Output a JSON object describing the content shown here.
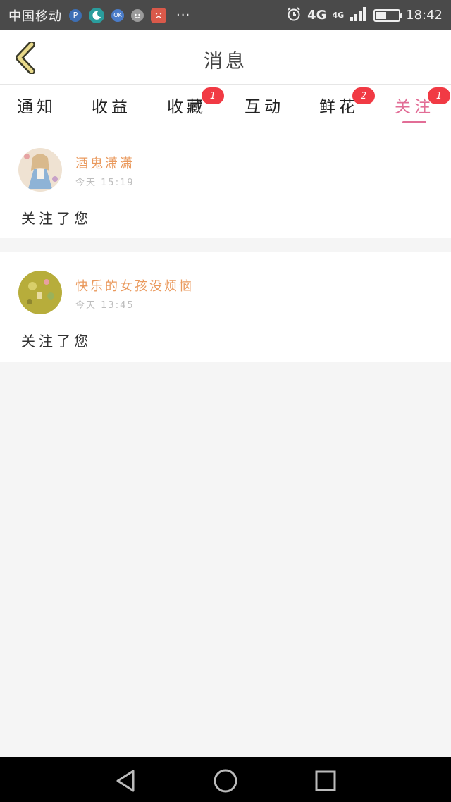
{
  "status_bar": {
    "carrier": "中国移动",
    "more": "···",
    "network_large": "4G",
    "network_small": "4G",
    "time": "18:42",
    "battery_level": 0.45,
    "icons": [
      "app-icon-p",
      "moon-app-icon",
      "ok-app-icon",
      "face-app-icon",
      "sad-app-icon",
      "alarm-icon",
      "signal-icon",
      "battery-icon"
    ]
  },
  "header": {
    "title": "消息"
  },
  "tabs": [
    {
      "label": "通知",
      "badge": ""
    },
    {
      "label": "收益",
      "badge": ""
    },
    {
      "label": "收藏",
      "badge": "1"
    },
    {
      "label": "互动",
      "badge": ""
    },
    {
      "label": "鲜花",
      "badge": "2"
    },
    {
      "label": "关注",
      "badge": "1",
      "active": true
    }
  ],
  "colors": {
    "accent": "#e26d96",
    "badge": "#f13a44",
    "username": "#ea9a5e",
    "back_arrow": "#e8d98a"
  },
  "messages": [
    {
      "username": "酒鬼潇潇",
      "day": "今天",
      "time": "15:19",
      "text": "关注了您"
    },
    {
      "username": "快乐的女孩没烦恼",
      "day": "今天",
      "time": "13:45",
      "text": "关注了您"
    }
  ],
  "nav_bar": {
    "icons": [
      "back-triangle-icon",
      "home-circle-icon",
      "recents-square-icon"
    ]
  }
}
